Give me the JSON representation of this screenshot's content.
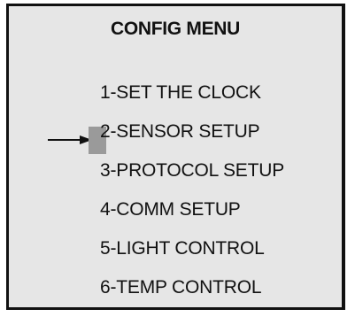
{
  "menu": {
    "title": "CONFIG MENU",
    "items": [
      {
        "label": "1-SET THE CLOCK"
      },
      {
        "label": "2-SENSOR SETUP"
      },
      {
        "label": "3-PROTOCOL SETUP"
      },
      {
        "label": "4-COMM SETUP"
      },
      {
        "label": "5-LIGHT CONTROL"
      },
      {
        "label": "6-TEMP CONTROL"
      }
    ],
    "selected_index": 1,
    "cursor_color": "#9a9a9a",
    "background_color": "#e6e6e6",
    "pointer_icon": "arrow-right-icon"
  }
}
